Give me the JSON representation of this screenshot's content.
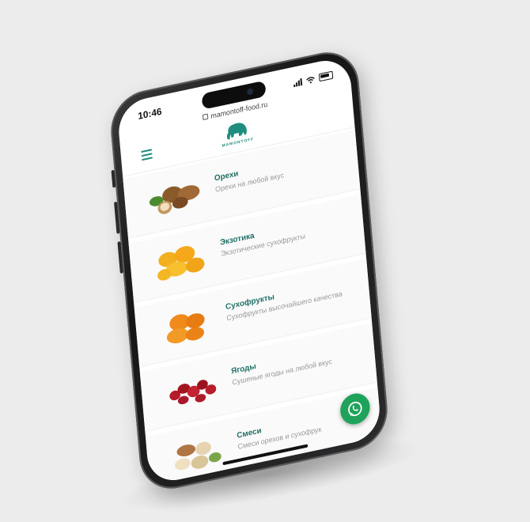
{
  "status_bar": {
    "time": "10:46"
  },
  "browser": {
    "url": "mamontoff-food.ru"
  },
  "header": {
    "logo_text": "MAMONTOFF"
  },
  "categories": [
    {
      "title": "Орехи",
      "description": "Орехи на любой вкус",
      "icon": "nuts-image"
    },
    {
      "title": "Экзотика",
      "description": "Экзотические сухофрукты",
      "icon": "apricot-image"
    },
    {
      "title": "Сухофрукты",
      "description": "Сухофрукты высочайшего качества",
      "icon": "dried-fruit-image"
    },
    {
      "title": "Ягоды",
      "description": "Сушеные ягоды на любой вкус",
      "icon": "berries-image"
    },
    {
      "title": "Смеси",
      "description": "Смеси орехов и сухофрук",
      "icon": "mix-image"
    }
  ],
  "colors": {
    "accent": "#1e8c7e",
    "whatsapp": "#1fa35a",
    "background": "#ececec"
  },
  "fab": {
    "icon": "whatsapp-icon"
  }
}
